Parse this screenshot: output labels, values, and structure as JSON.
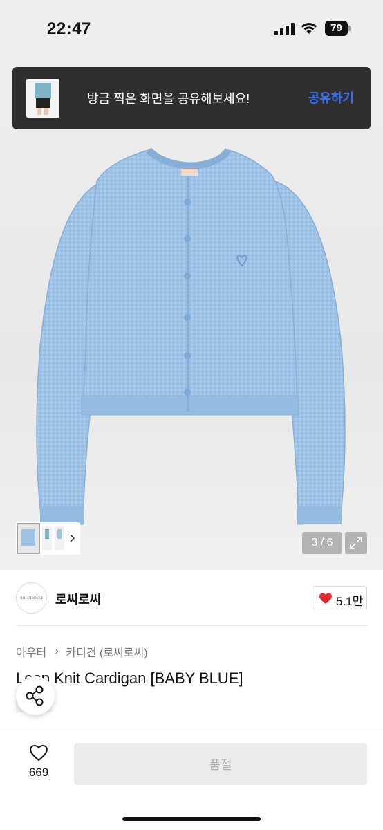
{
  "status_bar": {
    "time": "22:47",
    "battery": "79"
  },
  "share_toast": {
    "message": "방금 찍은 화면을 공유해보세요!",
    "action": "공유하기"
  },
  "gallery": {
    "counter": "3 / 6",
    "brand_tag": "rocci"
  },
  "brand": {
    "logo_text": "ROCCIROCCI",
    "name": "로씨로씨",
    "like_count": "5.1만"
  },
  "breadcrumb": {
    "level1": "아우터",
    "level2": "카디건 (로씨로씨)"
  },
  "product": {
    "title": "Loop Knit Cardigan [BABY BLUE]"
  },
  "bottom_bar": {
    "wish_count": "669",
    "buy_label": "품절"
  },
  "colors": {
    "accent": "#3b6ff5",
    "heart": "#e3242b",
    "cardigan": "#9ec3e6"
  }
}
